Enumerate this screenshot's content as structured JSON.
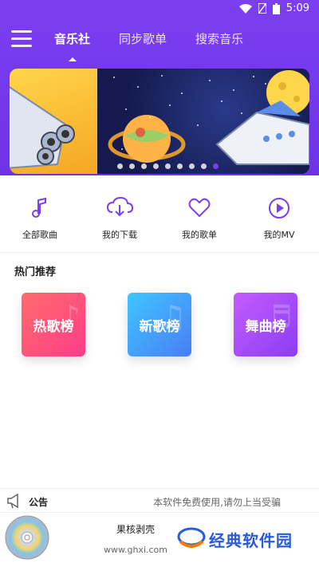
{
  "status": {
    "time": "5:09"
  },
  "tabs": [
    {
      "label": "音乐社"
    },
    {
      "label": "同步歌单"
    },
    {
      "label": "搜索音乐"
    }
  ],
  "banner": {
    "dot_count": 9,
    "active_index": 8
  },
  "quick": [
    {
      "label": "全部歌曲",
      "icon": "music-note-icon"
    },
    {
      "label": "我的下载",
      "icon": "cloud-download-icon"
    },
    {
      "label": "我的歌单",
      "icon": "heart-icon"
    },
    {
      "label": "我的MV",
      "icon": "play-circle-icon"
    }
  ],
  "section": {
    "title": "热门推荐"
  },
  "cards": [
    {
      "label": "热歌榜",
      "colors": [
        "#ff6b6b",
        "#ff3d8a"
      ]
    },
    {
      "label": "新歌榜",
      "colors": [
        "#3ec6ff",
        "#4a7df5"
      ]
    },
    {
      "label": "舞曲榜",
      "colors": [
        "#c45cff",
        "#8a3df2"
      ]
    }
  ],
  "notice": {
    "title": "公告",
    "text": "本软件免费使用,请勿上当受骗"
  },
  "player": {
    "song": "果核剥壳",
    "artist": "www.ghxi.com"
  },
  "watermark": {
    "text": "经典软件园"
  },
  "colors": {
    "accent": "#7b3ff0"
  }
}
